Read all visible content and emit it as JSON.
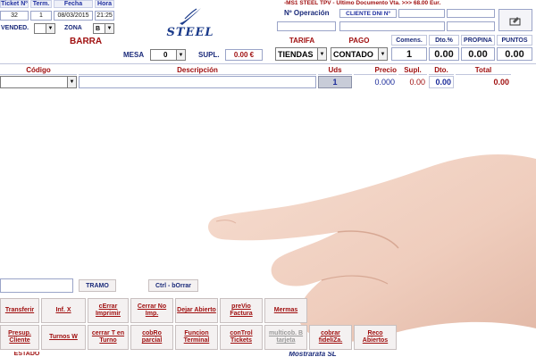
{
  "ticket": {
    "labels": {
      "ticket_no": "Ticket Nº",
      "term": "Term.",
      "fecha": "Fecha",
      "hora": "Hora"
    },
    "values": {
      "ticket_no": "32",
      "term": "1",
      "fecha": "08/03/2015",
      "hora": "21:25"
    }
  },
  "vendedor": {
    "label": "VENDED.",
    "zona_label": "ZONA",
    "zona_value": "B"
  },
  "barra_label": "BARRA",
  "mesa": {
    "label": "MESA",
    "value": "0",
    "supl_label": "SUPL.",
    "supl_value": "0.00 €"
  },
  "logo_text": "STEEL",
  "marquee": "-MS1 STEEL TPV - Ultimo Documento Vta. >>> 68.00 Eur.",
  "operacion_label": "Nº Operación",
  "cliente_label": "CLIENTE DNI Nº",
  "tarifa": {
    "label": "TARIFA",
    "value": "TIENDAS"
  },
  "pago": {
    "label": "PAGO",
    "value": "CONTADO"
  },
  "comens": {
    "label": "Comens.",
    "value": "1"
  },
  "dto": {
    "label": "Dto.%",
    "value": "0.00"
  },
  "propina": {
    "label": "PROPINA",
    "value": "0.00"
  },
  "puntos": {
    "label": "PUNTOS",
    "value": "0.00"
  },
  "table": {
    "headers": {
      "codigo": "Código",
      "descripcion": "Descripción",
      "uds": "Uds",
      "precio": "Precio",
      "supl": "Supl.",
      "dto": "Dto.",
      "total": "Total"
    },
    "row": {
      "uds": "1",
      "precio": "0.000",
      "supl": "0.00",
      "dto": "0.00",
      "total": "0.00"
    }
  },
  "tramo_label": "TRAMO",
  "borrar_label": "Ctrl - bOrrar",
  "buttons_row1": [
    {
      "label": "Transferir",
      "gray": false
    },
    {
      "label": "Inf. X",
      "gray": false
    },
    {
      "label": "cErrar Imprimir",
      "gray": false
    },
    {
      "label": "Cerrar No Imp.",
      "gray": false
    },
    {
      "label": "Dejar Abierto",
      "gray": false
    },
    {
      "label": "preVio Factura",
      "gray": false
    },
    {
      "label": "Mermas",
      "gray": false
    }
  ],
  "buttons_row2": [
    {
      "label": "Presup. Cliente",
      "gray": false
    },
    {
      "label": "Turnos W",
      "gray": false
    },
    {
      "label": "cerrar T en Turno",
      "gray": false
    },
    {
      "label": "cobRo parcial",
      "gray": false
    },
    {
      "label": "Funcion Terminal",
      "gray": false
    },
    {
      "label": "conTrol Tickets",
      "gray": false
    },
    {
      "label": "multicob. B tarjeta",
      "gray": true
    },
    {
      "label": "cobrar fideliZa.",
      "gray": false
    },
    {
      "label": "Reco Abiertos",
      "gray": false
    }
  ],
  "estado_label": "ESTADO",
  "footer_text": "Mostrarafa SL"
}
